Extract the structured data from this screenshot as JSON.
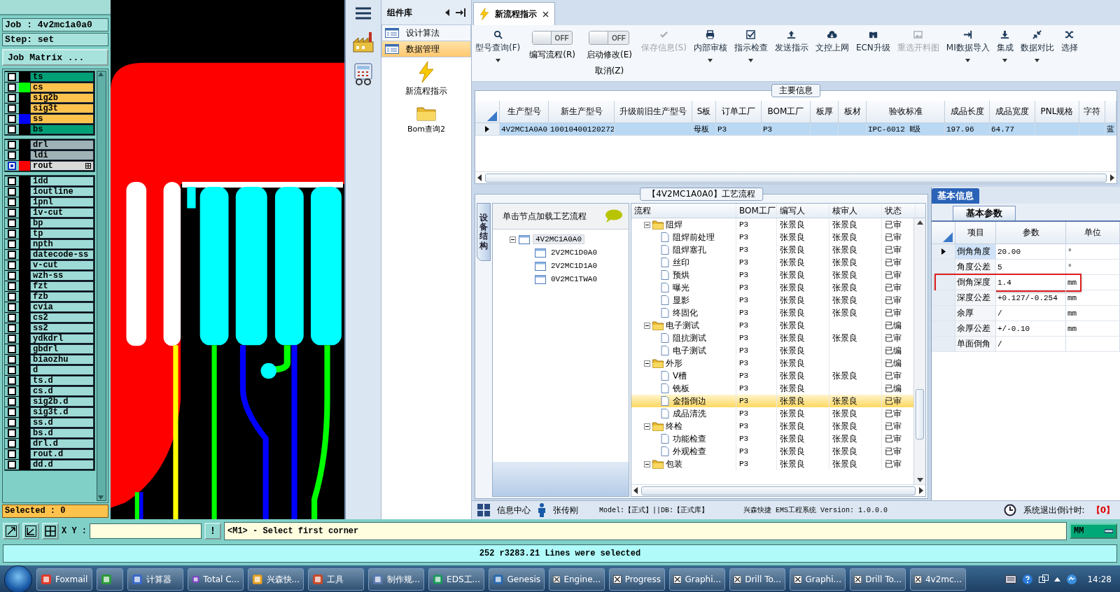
{
  "genesis": {
    "job": "Job : 4v2mc1a0a0",
    "step": "Step: set",
    "matrix_button": "Job Matrix ...",
    "layer_groups": [
      {
        "layers": [
          {
            "name": "ts",
            "kind": "mask",
            "selected": false
          },
          {
            "name": "cs",
            "kind": "signal",
            "color": "#00ff00",
            "selected": false
          },
          {
            "name": "sig2b",
            "kind": "signal",
            "selected": false
          },
          {
            "name": "sig3t",
            "kind": "signal",
            "selected": false
          },
          {
            "name": "ss",
            "kind": "signal",
            "color": "#0000ff",
            "selected": false
          },
          {
            "name": "bs",
            "kind": "mask",
            "selected": false
          }
        ]
      },
      {
        "layers": [
          {
            "name": "drl",
            "kind": "drill",
            "selected": false
          },
          {
            "name": "ldi",
            "kind": "drill",
            "selected": false
          },
          {
            "name": "rout",
            "kind": "rout",
            "color": "#ff0000",
            "selected": true
          }
        ]
      },
      {
        "layers": [
          {
            "name": "1dd",
            "kind": "misc",
            "selected": false
          },
          {
            "name": "1outline",
            "kind": "misc",
            "selected": false
          },
          {
            "name": "1pnl",
            "kind": "misc",
            "selected": false
          },
          {
            "name": "1v-cut",
            "kind": "misc",
            "selected": false
          },
          {
            "name": "bp",
            "kind": "misc",
            "selected": false
          },
          {
            "name": "tp",
            "kind": "misc",
            "selected": false
          },
          {
            "name": "npth",
            "kind": "misc",
            "selected": false
          },
          {
            "name": "datecode-ss",
            "kind": "misc",
            "selected": false
          },
          {
            "name": "v-cut",
            "kind": "misc",
            "selected": false
          },
          {
            "name": "wzh-ss",
            "kind": "misc",
            "selected": false
          },
          {
            "name": "fzt",
            "kind": "misc",
            "selected": false
          },
          {
            "name": "fzb",
            "kind": "misc",
            "selected": false
          },
          {
            "name": "cvia",
            "kind": "misc",
            "selected": false
          },
          {
            "name": "cs2",
            "kind": "misc",
            "selected": false
          },
          {
            "name": "ss2",
            "kind": "misc",
            "selected": false
          },
          {
            "name": "ydkdrl",
            "kind": "misc",
            "selected": false
          },
          {
            "name": "gbdrl",
            "kind": "misc",
            "selected": false
          },
          {
            "name": "biaozhu",
            "kind": "misc",
            "selected": false
          },
          {
            "name": "d",
            "kind": "misc",
            "selected": false
          },
          {
            "name": "ts.d",
            "kind": "misc",
            "selected": false
          },
          {
            "name": "cs.d",
            "kind": "misc",
            "selected": false
          },
          {
            "name": "sig2b.d",
            "kind": "misc",
            "selected": false
          },
          {
            "name": "sig3t.d",
            "kind": "misc",
            "selected": false
          },
          {
            "name": "ss.d",
            "kind": "misc",
            "selected": false
          },
          {
            "name": "bs.d",
            "kind": "misc",
            "selected": false
          },
          {
            "name": "drl.d",
            "kind": "misc",
            "selected": false
          },
          {
            "name": "rout.d",
            "kind": "misc",
            "selected": false
          },
          {
            "name": "dd.d",
            "kind": "misc",
            "selected": false
          }
        ]
      }
    ],
    "selected_count": "Selected : 0"
  },
  "eds": {
    "component_panel": {
      "title": "组件库",
      "items": [
        {
          "label": "设计算法",
          "selected": false
        },
        {
          "label": "数据管理",
          "selected": true
        }
      ],
      "tiles": [
        {
          "label": "新流程指示",
          "kind": "lightning"
        },
        {
          "label": "Bom查询2",
          "kind": "folder"
        }
      ]
    },
    "tabs": [
      {
        "label": "新流程指示",
        "selected": true
      }
    ],
    "toolbar": [
      {
        "kind": "button",
        "label": "型号查询(F)",
        "dropdown": true,
        "disabled": false
      },
      {
        "kind": "toggle",
        "label": "编写流程(R)",
        "switch": "OFF",
        "on": false
      },
      {
        "kind": "toggle",
        "label": "启动修改(E)",
        "sublabel": "取消(Z)",
        "switch": "OFF",
        "on": false
      },
      {
        "kind": "button",
        "label": "保存信息(S)",
        "dropdown": false,
        "disabled": true
      },
      {
        "kind": "button",
        "label": "内部审核",
        "dropdown": true,
        "disabled": false
      },
      {
        "kind": "button",
        "label": "指示检查",
        "dropdown": true,
        "disabled": false
      },
      {
        "kind": "button",
        "label": "发送指示",
        "dropdown": false,
        "disabled": false
      },
      {
        "kind": "button",
        "label": "文控上网",
        "dropdown": false,
        "disabled": false
      },
      {
        "kind": "button",
        "label": "ECN升级",
        "dropdown": false,
        "disabled": false
      },
      {
        "kind": "button",
        "label": "重选开料图",
        "dropdown": false,
        "disabled": true
      },
      {
        "kind": "button",
        "label": "MI数据导入",
        "dropdown": true,
        "disabled": false
      },
      {
        "kind": "button",
        "label": "集成",
        "dropdown": true,
        "disabled": false
      },
      {
        "kind": "button",
        "label": "数据对比",
        "dropdown": true,
        "disabled": false
      },
      {
        "kind": "button",
        "label": "选择",
        "dropdown": false,
        "disabled": false
      }
    ],
    "main_info": {
      "title": "主要信息",
      "columns": [
        "生产型号",
        "新生产型号",
        "升级前旧生产型号",
        "S板",
        "订单工厂",
        "BOM工厂",
        "板厚",
        "板材",
        "验收标准",
        "成品长度",
        "成品宽度",
        "PNL规格",
        "字符"
      ],
      "rows": [
        {
          "current": true,
          "cells": [
            "4V2MC1A0A0",
            "10010400120272",
            null,
            "母板",
            "P3",
            "P3",
            null,
            null,
            "IPC-6012 Ⅱ级",
            "197.96",
            "64.77",
            null,
            null,
            "蓝"
          ]
        }
      ]
    },
    "process": {
      "title": "【4V2MC1A0A0】工艺流程",
      "side_tab": "设备结构",
      "hint": "单击节点加载工艺流程",
      "tree": [
        {
          "label": "4V2MC1A0A0",
          "expanded": true,
          "selected": true,
          "children": [
            {
              "label": "2V2MC1D0A0",
              "selected": false
            },
            {
              "label": "2V2MC1D1A0",
              "selected": false
            },
            {
              "label": "0V2MC1TWA0",
              "selected": false
            }
          ]
        }
      ],
      "columns": [
        "流程",
        "BOM工厂",
        "编写人",
        "核审人",
        "状态"
      ],
      "rows": [
        {
          "label": "阻焊",
          "bom": "P3",
          "writer": "张景良",
          "reviewer": "张景良",
          "status": "已审",
          "expanded": true,
          "selected": false,
          "children": [
            {
              "label": "阻焊前处理",
              "bom": "P3",
              "writer": "张景良",
              "reviewer": "张景良",
              "status": "已审",
              "selected": false
            },
            {
              "label": "阻焊塞孔",
              "bom": "P3",
              "writer": "张景良",
              "reviewer": "张景良",
              "status": "已审",
              "selected": false
            },
            {
              "label": "丝印",
              "bom": "P3",
              "writer": "张景良",
              "reviewer": "张景良",
              "status": "已审",
              "selected": false
            },
            {
              "label": "预烘",
              "bom": "P3",
              "writer": "张景良",
              "reviewer": "张景良",
              "status": "已审",
              "selected": false
            },
            {
              "label": "曝光",
              "bom": "P3",
              "writer": "张景良",
              "reviewer": "张景良",
              "status": "已审",
              "selected": false
            },
            {
              "label": "显影",
              "bom": "P3",
              "writer": "张景良",
              "reviewer": "张景良",
              "status": "已审",
              "selected": false
            },
            {
              "label": "终固化",
              "bom": "P3",
              "writer": "张景良",
              "reviewer": "张景良",
              "status": "已审",
              "selected": false
            }
          ]
        },
        {
          "label": "电子测试",
          "bom": "P3",
          "writer": "张景良",
          "status": "已编",
          "expanded": true,
          "selected": false,
          "children": [
            {
              "label": "阻抗测试",
              "bom": "P3",
              "writer": "张景良",
              "reviewer": "张景良",
              "status": "已审",
              "selected": false
            },
            {
              "label": "电子测试",
              "bom": "P3",
              "writer": "张景良",
              "status": "已编",
              "selected": false
            }
          ]
        },
        {
          "label": "外形",
          "bom": "P3",
          "writer": "张景良",
          "status": "已编",
          "expanded": true,
          "selected": false,
          "children": [
            {
              "label": "V槽",
              "bom": "P3",
              "writer": "张景良",
              "reviewer": "张景良",
              "status": "已审",
              "selected": false
            },
            {
              "label": "铣板",
              "bom": "P3",
              "writer": "张景良",
              "status": "已编",
              "selected": false
            },
            {
              "label": "金指倒边",
              "bom": "P3",
              "writer": "张景良",
              "reviewer": "张景良",
              "status": "已审",
              "selected": true
            },
            {
              "label": "成品清洗",
              "bom": "P3",
              "writer": "张景良",
              "reviewer": "张景良",
              "status": "已审",
              "selected": false
            }
          ]
        },
        {
          "label": "终检",
          "bom": "P3",
          "writer": "张景良",
          "reviewer": "张景良",
          "status": "已审",
          "expanded": true,
          "selected": false,
          "children": [
            {
              "label": "功能检查",
              "bom": "P3",
              "writer": "张景良",
              "reviewer": "张景良",
              "status": "已审",
              "selected": false
            },
            {
              "label": "外观检查",
              "bom": "P3",
              "writer": "张景良",
              "reviewer": "张景良",
              "status": "已审",
              "selected": false
            }
          ]
        },
        {
          "label": "包装",
          "bom": "P3",
          "writer": "张景良",
          "reviewer": "张景良",
          "status": "已审",
          "expanded": true,
          "selected": false
        }
      ]
    },
    "params": {
      "tab": "基本信息",
      "subtab": "基本参数",
      "columns": [
        "项目",
        "参数",
        "单位"
      ],
      "rows": [
        {
          "item": "倒角角度",
          "value": "20.00",
          "unit": "°",
          "current": true,
          "highlighted": false
        },
        {
          "item": "角度公差",
          "value": "5",
          "unit": "°",
          "current": false,
          "highlighted": false
        },
        {
          "item": "倒角深度",
          "value": "1.4",
          "unit": "mm",
          "current": false,
          "highlighted": true
        },
        {
          "item": "深度公差",
          "value": "+0.127/-0.254",
          "unit": "mm",
          "current": false,
          "highlighted": false
        },
        {
          "item": "余厚",
          "value": "/",
          "unit": "mm",
          "current": false,
          "highlighted": false
        },
        {
          "item": "余厚公差",
          "value": "+/-0.10",
          "unit": "mm",
          "current": false,
          "highlighted": false
        },
        {
          "item": "单面倒角",
          "value": "/",
          "current": false,
          "highlighted": false
        }
      ]
    },
    "status": {
      "info": "信息中心",
      "user": "张传刚",
      "model": "Model:【正式】||DB:【正式库】",
      "system": "兴森快捷 EMS工程系统 Version: 1.0.0.0",
      "countdown_label": "系统退出倒计时:",
      "countdown": "【0】"
    }
  },
  "genesis_bottom": {
    "xy_label": "X Y :",
    "alert": "!",
    "prompt": "<M1> - Select first corner",
    "units": "MM",
    "message": "252 r3283.21 Lines were selected"
  },
  "taskbar": {
    "items": [
      {
        "kind": "app",
        "label": "Foxmail"
      },
      {
        "kind": "app"
      },
      {
        "kind": "app",
        "label": "计算器"
      },
      {
        "kind": "app",
        "label": "Total C..."
      },
      {
        "kind": "app",
        "label": "兴森快..."
      },
      {
        "kind": "app",
        "label": "工具"
      },
      {
        "kind": "app",
        "label": "制作规..."
      },
      {
        "kind": "app",
        "label": "EDS工..."
      },
      {
        "kind": "app",
        "label": "Genesis"
      },
      {
        "kind": "window",
        "label": "Engine..."
      },
      {
        "kind": "window",
        "label": "Progress"
      },
      {
        "kind": "window",
        "label": "Graphi..."
      },
      {
        "kind": "window",
        "label": "Drill To..."
      },
      {
        "kind": "window",
        "label": "Graphi..."
      },
      {
        "kind": "window",
        "label": "Drill To..."
      },
      {
        "kind": "window",
        "label": "4v2mc..."
      }
    ],
    "clock": "14:28"
  }
}
